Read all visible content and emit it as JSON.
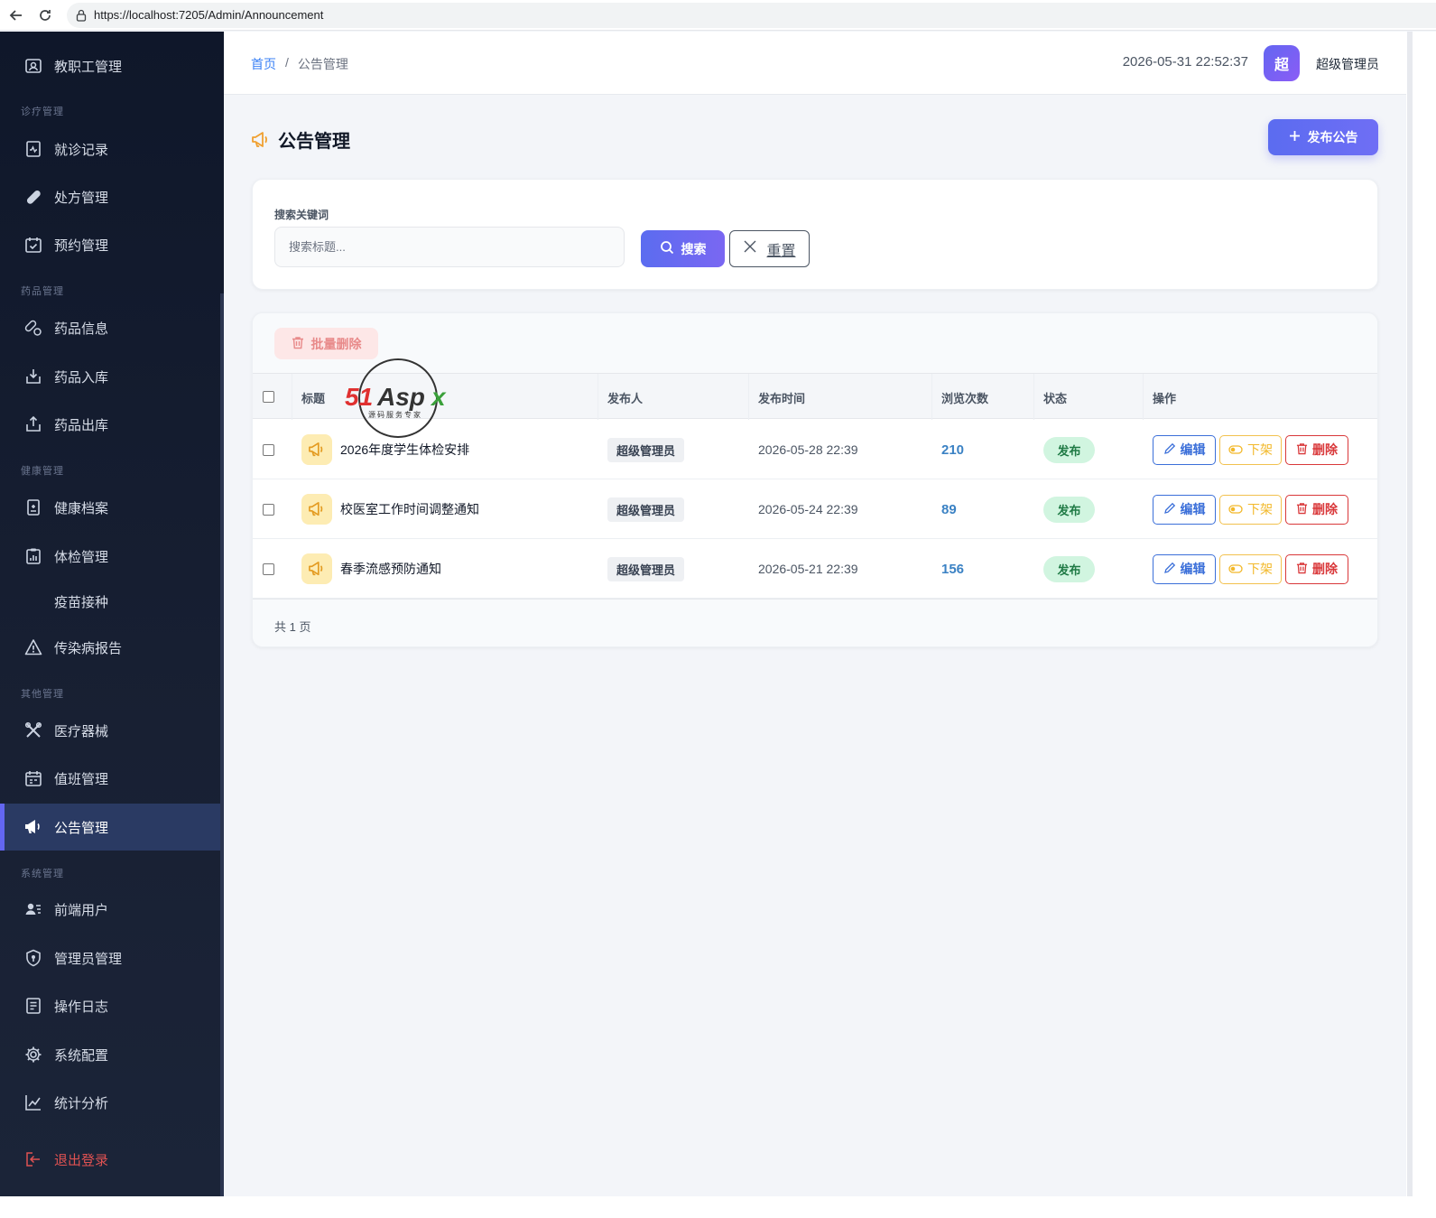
{
  "browser": {
    "url": "https://localhost:7205/Admin/Announcement"
  },
  "sidebar": {
    "items": [
      {
        "label": "教职工管理",
        "icon": "staff-icon"
      },
      {
        "group": "诊疗管理"
      },
      {
        "label": "就诊记录",
        "icon": "medical-record-icon"
      },
      {
        "label": "处方管理",
        "icon": "pill-icon"
      },
      {
        "label": "预约管理",
        "icon": "calendar-check-icon"
      },
      {
        "group": "药品管理"
      },
      {
        "label": "药品信息",
        "icon": "capsule-icon"
      },
      {
        "label": "药品入库",
        "icon": "box-in-icon"
      },
      {
        "label": "药品出库",
        "icon": "box-out-icon"
      },
      {
        "group": "健康管理"
      },
      {
        "label": "健康档案",
        "icon": "health-file-icon"
      },
      {
        "label": "体检管理",
        "icon": "clipboard-chart-icon"
      },
      {
        "label": "疫苗接种",
        "icon": ""
      },
      {
        "label": "传染病报告",
        "icon": "warning-icon"
      },
      {
        "group": "其他管理"
      },
      {
        "label": "医疗器械",
        "icon": "tools-icon"
      },
      {
        "label": "值班管理",
        "icon": "calendar-icon"
      },
      {
        "label": "公告管理",
        "icon": "megaphone-icon",
        "active": true
      },
      {
        "group": "系统管理"
      },
      {
        "label": "前端用户",
        "icon": "user-list-icon"
      },
      {
        "label": "管理员管理",
        "icon": "shield-icon"
      },
      {
        "label": "操作日志",
        "icon": "log-icon"
      },
      {
        "label": "系统配置",
        "icon": "gear-icon"
      },
      {
        "label": "统计分析",
        "icon": "line-chart-icon"
      },
      {
        "label": "退出登录",
        "icon": "logout-icon"
      }
    ]
  },
  "header": {
    "breadcrumb_home": "首页",
    "breadcrumb_sep": "/",
    "breadcrumb_current": "公告管理",
    "datetime": "2026-05-31 22:52:37",
    "avatar_text": "超",
    "user_name": "超级管理员"
  },
  "page": {
    "title": "公告管理",
    "publish_label": "发布公告"
  },
  "search": {
    "label": "搜索关键词",
    "placeholder": "搜索标题...",
    "value": "",
    "search_label": "搜索",
    "reset_label": "重置"
  },
  "table": {
    "batch_delete_label": "批量删除",
    "columns": [
      "标题",
      "发布人",
      "发布时间",
      "浏览次数",
      "状态",
      "操作"
    ],
    "rows": [
      {
        "title": "2026年度学生体检安排",
        "publisher": "超级管理员",
        "time": "2026-05-28 22:39",
        "views": "210",
        "status": "发布"
      },
      {
        "title": "校医室工作时间调整通知",
        "publisher": "超级管理员",
        "time": "2026-05-24 22:39",
        "views": "89",
        "status": "发布"
      },
      {
        "title": "春季流感预防通知",
        "publisher": "超级管理员",
        "time": "2026-05-21 22:39",
        "views": "156",
        "status": "发布"
      }
    ],
    "actions": {
      "edit": "编辑",
      "offline": "下架",
      "delete": "删除"
    },
    "footer": "共 1 页"
  },
  "watermark": {
    "brand": "51Aspx",
    "tagline": "源码服务专家"
  },
  "colors": {
    "accent": "#6366f1",
    "sidebar_bg": "#0f172a",
    "sidebar_active": "#2a3a63",
    "status_green": "#d1f5e0",
    "danger": "#d9383a",
    "warning": "#f2b82a"
  }
}
